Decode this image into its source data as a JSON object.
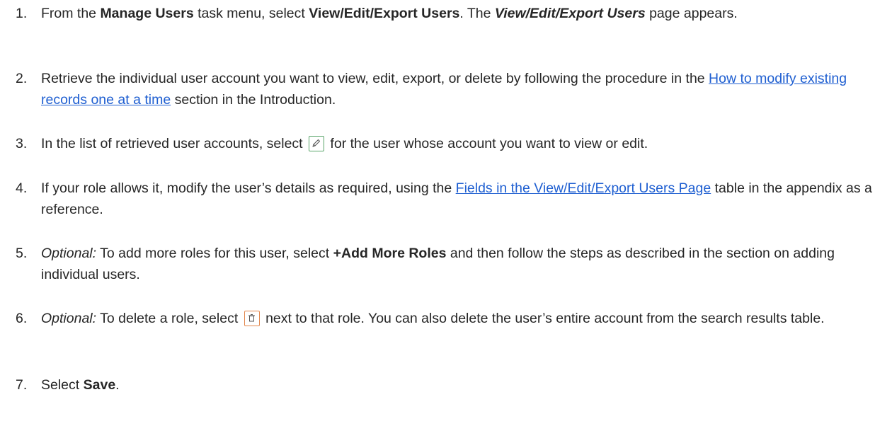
{
  "steps": [
    {
      "number": "1.",
      "a": "From the ",
      "b_manage": "Manage Users",
      "c": " task menu, select ",
      "d_view": "View/Edit/Export Users",
      "e": ". The ",
      "f_page": "View/Edit/Export Users",
      "g": " page appears."
    },
    {
      "number": "2.",
      "a": "Retrieve the individual user account you want to view, edit, export, or delete by following the procedure in the ",
      "link": "How to modify existing records one at a time",
      "b": " section in the Introduction."
    },
    {
      "number": "3.",
      "a": "In the list of retrieved user accounts, select ",
      "icon": "edit-pencil-icon",
      "b": " for the user whose account you want to view or edit."
    },
    {
      "number": "4.",
      "a": "If your role allows it, modify the user’s details as required, using the ",
      "link": "Fields in the View/Edit/Export Users Page",
      "b": " table in the appendix as a reference."
    },
    {
      "number": "5.",
      "optional": "Optional:",
      "a": " To add more roles for this user, select ",
      "bold": "+Add More Roles",
      "b": " and then follow the steps as described in the section on adding individual users."
    },
    {
      "number": "6.",
      "optional": "Optional:",
      "a": " To delete a role, select ",
      "icon": "trash-delete-icon",
      "b": " next to that role. You can also delete the user’s entire account from the search results table."
    },
    {
      "number": "7.",
      "a": "Select ",
      "bold": "Save",
      "b": "."
    }
  ],
  "colors": {
    "text": "#262626",
    "link": "#1f5fd1",
    "edit_icon_border": "#5aa56a",
    "delete_icon_border": "#e2874e"
  }
}
